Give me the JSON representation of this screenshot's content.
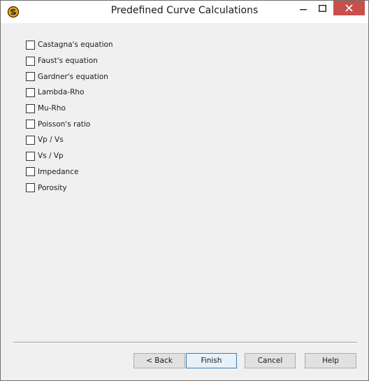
{
  "window": {
    "title": "Predefined Curve Calculations",
    "icon": "app-logo-icon",
    "close_color": "#c7504a"
  },
  "checklist": {
    "items": [
      {
        "label": "Castagna's equation",
        "checked": false
      },
      {
        "label": "Faust's equation",
        "checked": false
      },
      {
        "label": "Gardner's equation",
        "checked": false
      },
      {
        "label": "Lambda-Rho",
        "checked": false
      },
      {
        "label": "Mu-Rho",
        "checked": false
      },
      {
        "label": "Poisson's ratio",
        "checked": false
      },
      {
        "label": "Vp / Vs",
        "checked": false
      },
      {
        "label": "Vs / Vp",
        "checked": false
      },
      {
        "label": "Impedance",
        "checked": false
      },
      {
        "label": "Porosity",
        "checked": false
      }
    ]
  },
  "footer": {
    "back_label": "< Back",
    "finish_label": "Finish",
    "cancel_label": "Cancel",
    "help_label": "Help"
  }
}
